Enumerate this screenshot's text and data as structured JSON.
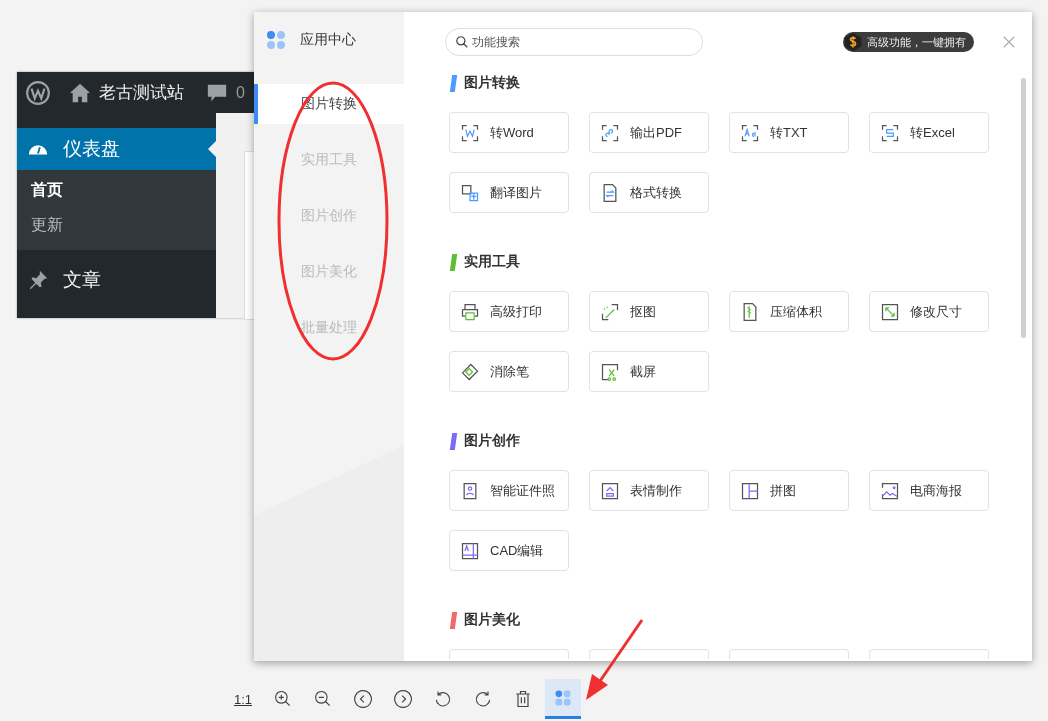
{
  "background_screenshot": {
    "site_name": "老古测试站",
    "comment_count": "0",
    "menu": [
      {
        "label": "仪表盘",
        "selected": true,
        "children": [
          {
            "label": "首页",
            "selected": true
          },
          {
            "label": "更新",
            "selected": false
          }
        ]
      },
      {
        "label": "文章",
        "selected": false
      }
    ]
  },
  "app_center": {
    "title": "应用中心",
    "nav": [
      {
        "label": "图片转换",
        "selected": true
      },
      {
        "label": "实用工具",
        "selected": false
      },
      {
        "label": "图片创作",
        "selected": false
      },
      {
        "label": "图片美化",
        "selected": false
      },
      {
        "label": "批量处理",
        "selected": false
      }
    ],
    "search": {
      "placeholder": "功能搜索"
    },
    "premium_badge": "高级功能，一键拥有",
    "sections": [
      {
        "title": "图片转换",
        "color": "#4e9bff",
        "items": [
          {
            "label": "转Word",
            "kind": "word"
          },
          {
            "label": "输出PDF",
            "kind": "pdf"
          },
          {
            "label": "转TXT",
            "kind": "txt"
          },
          {
            "label": "转Excel",
            "kind": "excel"
          },
          {
            "label": "翻译图片",
            "kind": "translate"
          },
          {
            "label": "格式转换",
            "kind": "format"
          }
        ]
      },
      {
        "title": "实用工具",
        "color": "#5bc035",
        "items": [
          {
            "label": "高级打印",
            "kind": "print"
          },
          {
            "label": "抠图",
            "kind": "cutout"
          },
          {
            "label": "压缩体积",
            "kind": "compress"
          },
          {
            "label": "修改尺寸",
            "kind": "resize"
          },
          {
            "label": "消除笔",
            "kind": "eraser"
          },
          {
            "label": "截屏",
            "kind": "screenshot"
          }
        ]
      },
      {
        "title": "图片创作",
        "color": "#7b6cf6",
        "items": [
          {
            "label": "智能证件照",
            "kind": "id-photo"
          },
          {
            "label": "表情制作",
            "kind": "emoji"
          },
          {
            "label": "拼图",
            "kind": "collage"
          },
          {
            "label": "电商海报",
            "kind": "poster"
          },
          {
            "label": "CAD编辑",
            "kind": "cad"
          }
        ]
      },
      {
        "title": "图片美化",
        "color": "#f26b6b",
        "items": [
          {
            "kind": "partial"
          },
          {
            "kind": "partial"
          },
          {
            "kind": "partial"
          },
          {
            "kind": "partial"
          }
        ]
      }
    ]
  },
  "toolbar": [
    {
      "kind": "actual-size",
      "label": "1:1",
      "selected": false
    },
    {
      "kind": "zoom-in",
      "selected": false
    },
    {
      "kind": "zoom-out",
      "selected": false
    },
    {
      "kind": "previous",
      "selected": false
    },
    {
      "kind": "next",
      "selected": false
    },
    {
      "kind": "rotate-left",
      "selected": false
    },
    {
      "kind": "rotate-right",
      "selected": false
    },
    {
      "kind": "delete",
      "selected": false
    },
    {
      "kind": "apps",
      "selected": true
    }
  ]
}
